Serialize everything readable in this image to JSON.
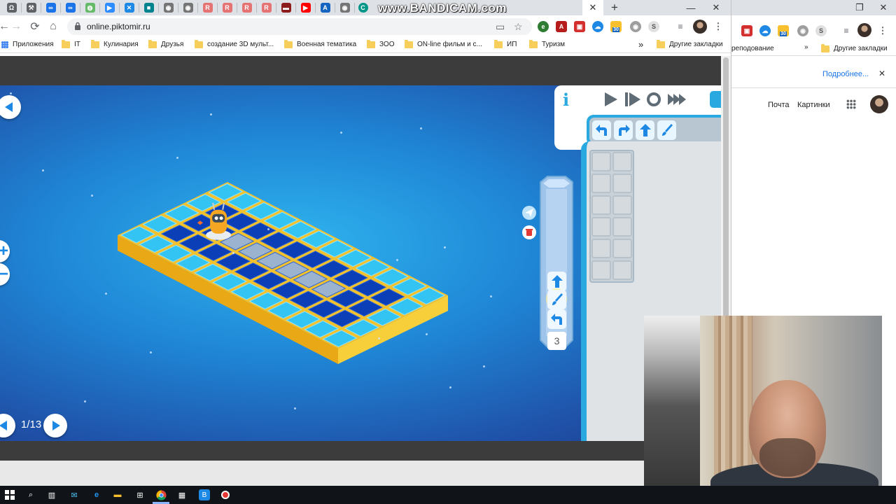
{
  "browser": {
    "watermark": "www.BANDICAM.com",
    "tabs": [
      {
        "icon": "omega-icon",
        "color": "#5f6368",
        "glyph": "Ω"
      },
      {
        "icon": "wrench-icon",
        "color": "#5f6368",
        "glyph": "⚒"
      },
      {
        "icon": "infinity-icon",
        "color": "#1a73e8",
        "glyph": "∞"
      },
      {
        "icon": "infinity-icon",
        "color": "#1a73e8",
        "glyph": "∞"
      },
      {
        "icon": "stepik-icon",
        "color": "#66bb6a",
        "glyph": "◍"
      },
      {
        "icon": "zoom-icon",
        "color": "#2d8cff",
        "glyph": "▶"
      },
      {
        "icon": "close-x-icon",
        "color": "#1e88e5",
        "glyph": "✕"
      },
      {
        "icon": "square-icon",
        "color": "#00838f",
        "glyph": "■"
      },
      {
        "icon": "globe-icon",
        "color": "#757575",
        "glyph": "◉"
      },
      {
        "icon": "globe-icon",
        "color": "#757575",
        "glyph": "◉"
      },
      {
        "icon": "r-icon",
        "color": "#e57373",
        "glyph": "R"
      },
      {
        "icon": "r-icon",
        "color": "#e57373",
        "glyph": "R"
      },
      {
        "icon": "r-icon",
        "color": "#e57373",
        "glyph": "R"
      },
      {
        "icon": "r-icon",
        "color": "#e57373",
        "glyph": "R"
      },
      {
        "icon": "video-icon",
        "color": "#8d1c1c",
        "glyph": "▬"
      },
      {
        "icon": "youtube-icon",
        "color": "#ff0000",
        "glyph": "▶"
      },
      {
        "icon": "a-icon",
        "color": "#1565c0",
        "glyph": "A"
      },
      {
        "icon": "globe-icon",
        "color": "#757575",
        "glyph": "◉"
      },
      {
        "icon": "c-icon",
        "color": "#009688",
        "glyph": "C"
      }
    ],
    "active_tab_close": "✕",
    "new_tab": "+",
    "url": "online.piktomir.ru",
    "bookmarks": [
      {
        "label": "Приложения",
        "kind": "apps"
      },
      {
        "label": "IT",
        "kind": "folder"
      },
      {
        "label": "Кулинария",
        "kind": "folder"
      },
      {
        "label": "Друзья",
        "kind": "folder"
      },
      {
        "label": "создание 3D мульт...",
        "kind": "folder"
      },
      {
        "label": "Военная тематика",
        "kind": "folder"
      },
      {
        "label": "ЗОО",
        "kind": "folder"
      },
      {
        "label": "ON-line фильм и с...",
        "kind": "folder"
      },
      {
        "label": "ИП",
        "kind": "folder"
      },
      {
        "label": "Туризм",
        "kind": "folder"
      }
    ],
    "bookmarks_more": "»",
    "other_bookmarks": "Другие закладки",
    "ext_badge": "30"
  },
  "game": {
    "level": "1/13",
    "counter": "3"
  },
  "right_window": {
    "partial_bookmark": "реподование",
    "bookmarks_more": "»",
    "other_bookmarks": "Другие закладки",
    "more_link": "Подробнее...",
    "close": "✕",
    "mail": "Почта",
    "images": "Картинки",
    "ext_badge": "30"
  },
  "colors": {
    "accent": "#2aa9e0",
    "gold": "#f2c12e",
    "tile_light": "#33c4f4",
    "tile_dark": "#0b3fb8"
  }
}
